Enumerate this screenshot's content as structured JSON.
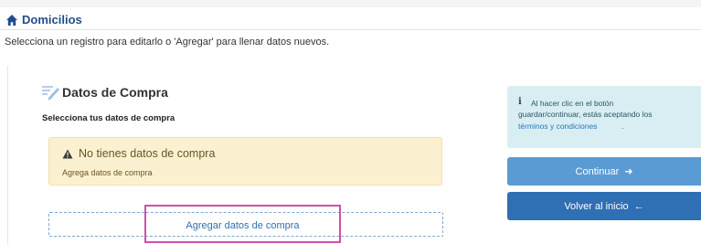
{
  "header": {
    "title": "Domicilios",
    "subtitle": "Selecciona un registro para editarlo o 'Agregar' para llenar datos nuevos."
  },
  "section": {
    "title": "Datos de Compra",
    "subtitle": "Selecciona tus datos de compra"
  },
  "warning": {
    "title": "No tienes datos de compra",
    "text": "Agrega datos de compra"
  },
  "add_button": {
    "label": "Agregar datos de compra"
  },
  "info": {
    "line1": "Al hacer clic en el botón",
    "line2": "guardar/continuar, estás aceptando los",
    "link": "términos y condiciones",
    "suffix": "."
  },
  "buttons": {
    "continue_label": "Continuar",
    "continue_arrow": "➜",
    "back_label": "Volver al inicio",
    "back_arrow": "←"
  },
  "icons": {
    "home": "home-icon",
    "pencil": "pencil-icon",
    "warning": "warning-icon",
    "info": "info-icon"
  },
  "colors": {
    "title_blue": "#1f4e8c",
    "warning_bg": "#fbf1d0",
    "info_bg": "#d9eef3",
    "continue_bg": "#5b9bd3",
    "back_bg": "#2f6fb3",
    "highlight": "#d14fa8"
  }
}
